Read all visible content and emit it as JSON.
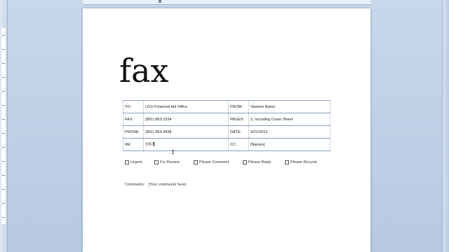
{
  "document": {
    "title": "fax",
    "fields": [
      {
        "label": "TO:",
        "value": "UVU Financial Aid Office",
        "label2": "FROM:",
        "value2": "Student Name"
      },
      {
        "label": "FAX:",
        "value": "(801) 863-2334",
        "label2": "PAGES:",
        "value2": "2, Including Cover Sheet"
      },
      {
        "label": "PHONE:",
        "value": "(801) 863-4998",
        "label2": "DATE:",
        "value2": "3/21/2013"
      },
      {
        "label": "RE:",
        "value": "1057",
        "label2": "CC:",
        "value2": "[Names]"
      }
    ],
    "checkboxes": [
      "Urgent",
      "For Review",
      "Please Comment",
      "Please Reply",
      "Please Recycle"
    ],
    "comments_label": "Comments:",
    "comments_placeholder": "[Your comments here]"
  },
  "colors": {
    "workspace": "#b7c9e1",
    "page": "#ffffff",
    "table_border": "#8aa0bd"
  },
  "icons": {
    "mouse_pointer": "ibeam-cursor-icon"
  }
}
